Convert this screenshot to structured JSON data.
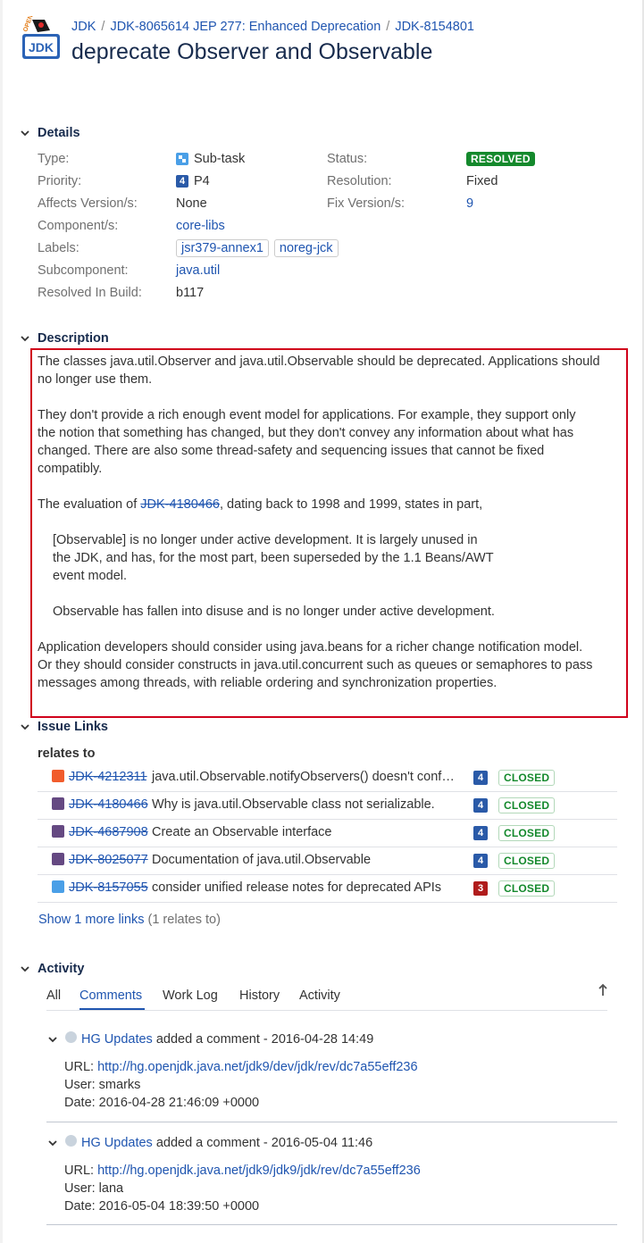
{
  "breadcrumb": {
    "project": "JDK",
    "parent": "JDK-8065614 JEP 277: Enhanced Deprecation",
    "issue": "JDK-8154801"
  },
  "issue": {
    "title": "deprecate Observer and Observable"
  },
  "logo": {
    "text_open": "OPEN",
    "text_jdk": "JDK"
  },
  "details": {
    "heading": "Details",
    "type": {
      "label": "Type:",
      "value": "Sub-task",
      "icon": "subtask-icon"
    },
    "priority": {
      "label": "Priority:",
      "value": "P4",
      "icon_text": "4"
    },
    "affects": {
      "label": "Affects Version/s:",
      "value": "None"
    },
    "component": {
      "label": "Component/s:",
      "value": "core-libs"
    },
    "labels": {
      "label": "Labels:",
      "values": [
        "jsr379-annex1",
        "noreg-jck"
      ]
    },
    "subcomponent": {
      "label": "Subcomponent:",
      "value": "java.util"
    },
    "resolved_in": {
      "label": "Resolved In Build:",
      "value": "b117"
    },
    "status": {
      "label": "Status:",
      "value": "RESOLVED"
    },
    "resolution": {
      "label": "Resolution:",
      "value": "Fixed"
    },
    "fix_version": {
      "label": "Fix Version/s:",
      "value": "9"
    }
  },
  "description": {
    "heading": "Description",
    "p1_l1": "The classes java.util.Observer and java.util.Observable should be deprecated. Applications should",
    "p1_l2": "no longer use them.",
    "p2_l1": "They don't provide a rich enough event model for applications. For example, they support only",
    "p2_l2": "the notion that something has changed, but they don't convey any information about what has",
    "p2_l3": "changed. There are also some thread-safety and sequencing issues that cannot be fixed",
    "p2_l4": "compatibly.",
    "p3_pre": "The evaluation of ",
    "p3_link": "JDK-4180466",
    "p3_post": ", dating back to 1998 and 1999, states in part,",
    "q1_l1": "[Observable] is no longer under active development. It is largely unused in",
    "q1_l2": "the JDK, and has, for the most part, been superseded by the 1.1 Beans/AWT",
    "q1_l3": "event model.",
    "q2": "Observable has fallen into disuse and is no longer under active development.",
    "p4_l1": "Application developers should consider using java.beans for a richer change notification model.",
    "p4_l2": "Or they should consider constructs in java.util.concurrent such as queues or semaphores to pass",
    "p4_l3": "messages among threads, with reliable ordering and synchronization properties."
  },
  "issue_links": {
    "heading": "Issue Links",
    "group": "relates to",
    "rows": [
      {
        "key": "JDK-4212311",
        "summary": "java.util.Observable.notifyObservers() doesn't conf…",
        "priority": "4",
        "status": "CLOSED",
        "type_color": "#f15c2c"
      },
      {
        "key": "JDK-4180466",
        "summary": "Why is java.util.Observable class not serializable.",
        "priority": "4",
        "status": "CLOSED",
        "type_color": "#654982"
      },
      {
        "key": "JDK-4687908",
        "summary": "Create an Observable interface",
        "priority": "4",
        "status": "CLOSED",
        "type_color": "#654982"
      },
      {
        "key": "JDK-8025077",
        "summary": "Documentation of java.util.Observable",
        "priority": "4",
        "status": "CLOSED",
        "type_color": "#654982"
      },
      {
        "key": "JDK-8157055",
        "summary": "consider unified release notes for deprecated APIs",
        "priority": "3",
        "status": "CLOSED",
        "type_color": "#4a9fe7"
      }
    ],
    "show_more": "Show 1 more links",
    "show_more_note": "(1 relates to)"
  },
  "activity": {
    "heading": "Activity",
    "tabs": [
      "All",
      "Comments",
      "Work Log",
      "History",
      "Activity"
    ],
    "active_tab": "Comments",
    "comments": [
      {
        "author": "HG Updates",
        "action": " added a comment - 2016-04-28 14:49",
        "url_label": "URL: ",
        "url": "http://hg.openjdk.java.net/jdk9/dev/jdk/rev/dc7a55eff236",
        "user": "User: smarks",
        "date": "Date: 2016-04-28 21:46:09 +0000"
      },
      {
        "author": "HG Updates",
        "action": " added a comment - 2016-05-04 11:46",
        "url_label": "URL: ",
        "url": "http://hg.openjdk.java.net/jdk9/jdk9/jdk/rev/dc7a55eff236",
        "user": "User: lana",
        "date": "Date: 2016-05-04 18:39:50 +0000"
      }
    ]
  },
  "colors": {
    "link": "#1f55b0",
    "highlight_border": "#d0021b",
    "resolved": "#14892c"
  }
}
